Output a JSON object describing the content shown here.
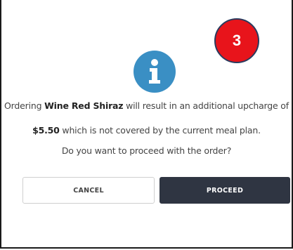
{
  "badge": {
    "number": "3",
    "color": "#e8141b"
  },
  "icon": {
    "name": "info-icon",
    "color": "#3a8fc4"
  },
  "message": {
    "line1_prefix": "Ordering ",
    "item_name": "Wine Red Shiraz",
    "line1_suffix": " will result in an additional upcharge of",
    "price": "$5.50",
    "line2_suffix": " which is not covered by the current meal plan.",
    "question": "Do you want to proceed with the order?"
  },
  "buttons": {
    "cancel_label": "CANCEL",
    "proceed_label": "PROCEED",
    "proceed_color": "#2f3542"
  }
}
